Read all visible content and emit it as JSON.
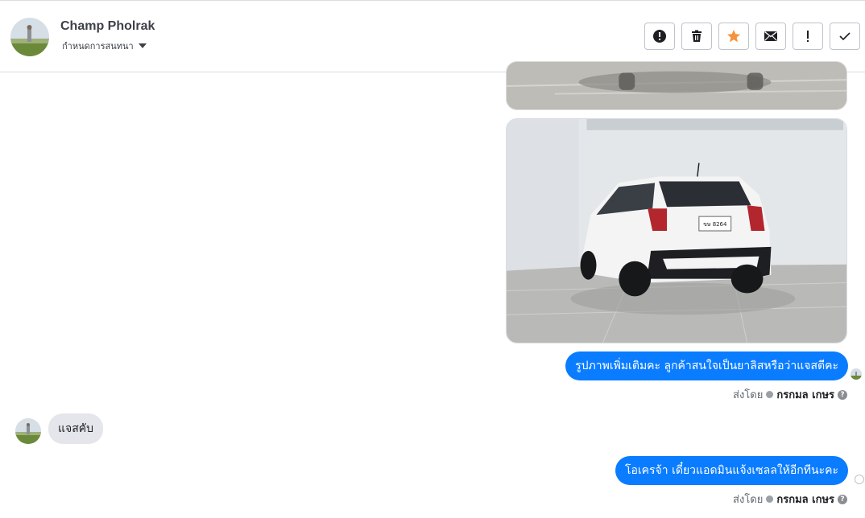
{
  "header": {
    "contact_name": "Champ Pholrak",
    "conversation_label": "กำหนดการสนทนา",
    "actions": [
      {
        "name": "report-spam-button",
        "icon": "alert-circle-icon"
      },
      {
        "name": "delete-button",
        "icon": "trash-icon"
      },
      {
        "name": "star-button",
        "icon": "star-icon"
      },
      {
        "name": "mark-unread-button",
        "icon": "envelope-icon"
      },
      {
        "name": "follow-up-button",
        "icon": "exclamation-icon"
      },
      {
        "name": "mark-done-button",
        "icon": "check-icon"
      }
    ],
    "star_color": "#f7923b"
  },
  "messages": [
    {
      "type": "image",
      "from": "page",
      "subject": "car interior floor (cropped)"
    },
    {
      "type": "image",
      "from": "page",
      "subject": "white hatchback rear view",
      "plate_text": "ขษ 8264"
    },
    {
      "type": "text",
      "from": "page",
      "text": "รูปภาพเพิ่มเติมคะ ลูกค้าสนใจเป็นยาลิสหรือว่าแจสตีคะ"
    },
    {
      "type": "text",
      "from": "customer",
      "text": "แจสคับ"
    },
    {
      "type": "text",
      "from": "page",
      "text": "โอเครจ้า เดี๋ยวแอดมินแจ้งเซลลให้อีกทีนะคะ"
    }
  ],
  "sent_by": {
    "prefix": "ส่งโดย",
    "agent": "กรกมล เกษร",
    "help": "?"
  },
  "colors": {
    "outgoing_bubble": "#0a7cff",
    "incoming_bubble": "#e4e6eb"
  }
}
